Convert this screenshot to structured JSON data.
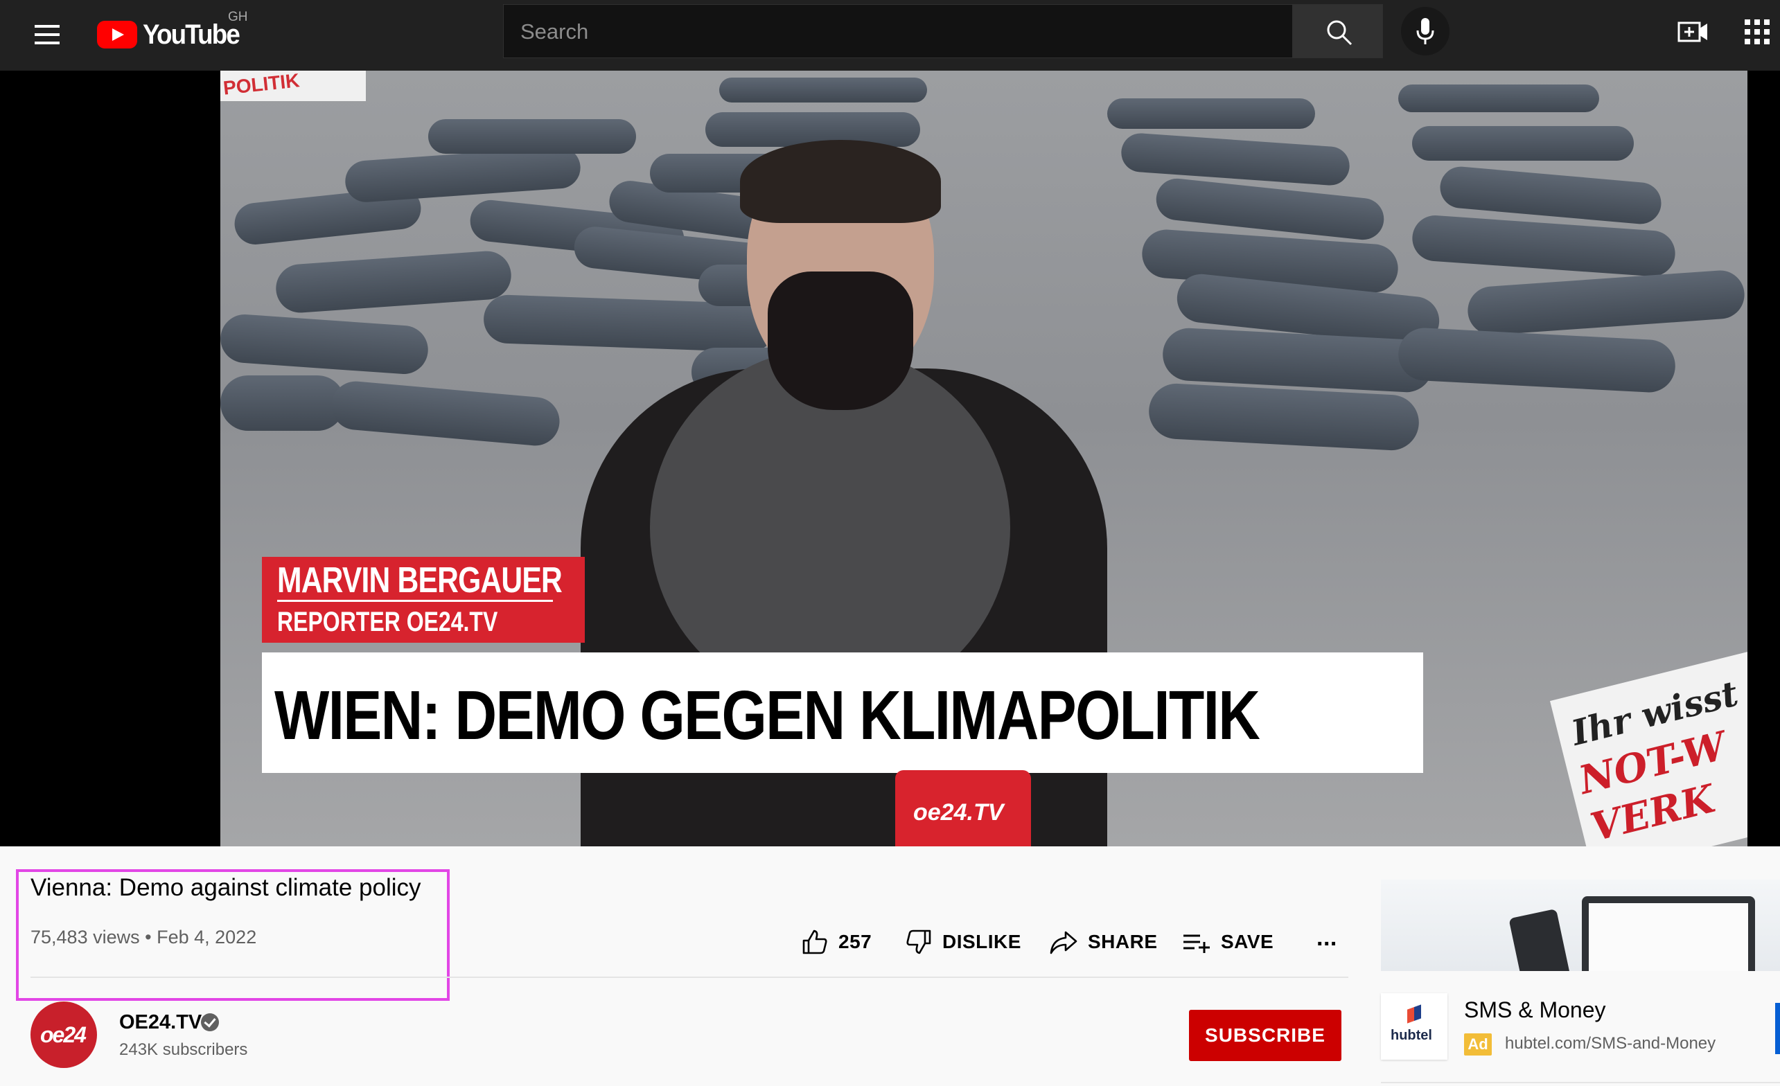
{
  "header": {
    "logo_text": "YouTube",
    "region": "GH",
    "search_placeholder": "Search"
  },
  "video": {
    "overlay": {
      "name": "MARVIN BERGAUER",
      "role": "REPORTER OE24.TV",
      "headline": "WIEN: DEMO GEGEN KLIMAPOLITIK",
      "mic_brand": "oe24.TV",
      "sign_line1": "Ihr wisst",
      "sign_line2": "NOT-W",
      "sign_line3": "VERK",
      "banner": "POLITIK"
    },
    "title": "Vienna: Demo against climate policy",
    "views": "75,483 views",
    "separator": "•",
    "date": "Feb 4, 2022"
  },
  "actions": {
    "like_count": "257",
    "dislike": "DISLIKE",
    "share": "SHARE",
    "save": "SAVE",
    "more": "..."
  },
  "channel": {
    "avatar_text": "oe24",
    "name": "OE24.TV",
    "subscribers": "243K subscribers",
    "subscribe": "SUBSCRIBE"
  },
  "ad": {
    "logo_text": "hubtel",
    "title": "SMS & Money",
    "badge": "Ad",
    "url": "hubtel.com/SMS-and-Money"
  },
  "colors": {
    "brand_red": "#ff0000",
    "subscribe_red": "#cc0000",
    "highlight": "#e247e6",
    "ad_badge": "#f2bd38"
  }
}
